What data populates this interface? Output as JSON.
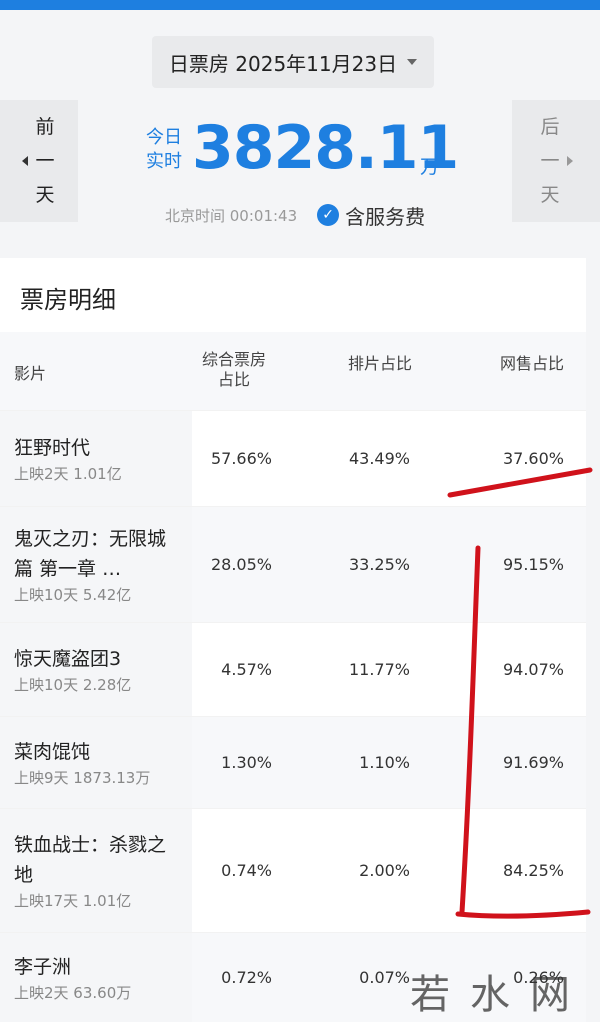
{
  "header": {
    "date_selector": "日票房 2025年11月23日",
    "prev_label": "前一天",
    "next_label": "后一天",
    "today_label": "今日实时",
    "total": "3828.11",
    "unit": "万",
    "time_label": "北京时间 00:01:43",
    "service_label": "含服务费"
  },
  "section_title": "票房明细",
  "table": {
    "columns": [
      "影片",
      "综合票房占比",
      "排片占比",
      "网售占比"
    ],
    "rows": [
      {
        "title": "狂野时代",
        "sub": "上映2天 1.01亿",
        "box": "57.66%",
        "show": "43.49%",
        "online": "37.60%"
      },
      {
        "title": "鬼灭之刃：无限城篇 第一章 …",
        "sub": "上映10天 5.42亿",
        "box": "28.05%",
        "show": "33.25%",
        "online": "95.15%"
      },
      {
        "title": "惊天魔盗团3",
        "sub": "上映10天 2.28亿",
        "box": "4.57%",
        "show": "11.77%",
        "online": "94.07%"
      },
      {
        "title": "菜肉馄饨",
        "sub": "上映9天 1873.13万",
        "box": "1.30%",
        "show": "1.10%",
        "online": "91.69%"
      },
      {
        "title": "铁血战士：杀戮之地",
        "sub": "上映17天 1.01亿",
        "box": "0.74%",
        "show": "2.00%",
        "online": "84.25%"
      },
      {
        "title": "李子洲",
        "sub": "上映2天 63.60万",
        "box": "0.72%",
        "show": "0.07%",
        "online": "0.26%"
      }
    ]
  },
  "watermark": "若水网",
  "colors": {
    "accent": "#1e7fe0",
    "ink": "#d0121b"
  }
}
